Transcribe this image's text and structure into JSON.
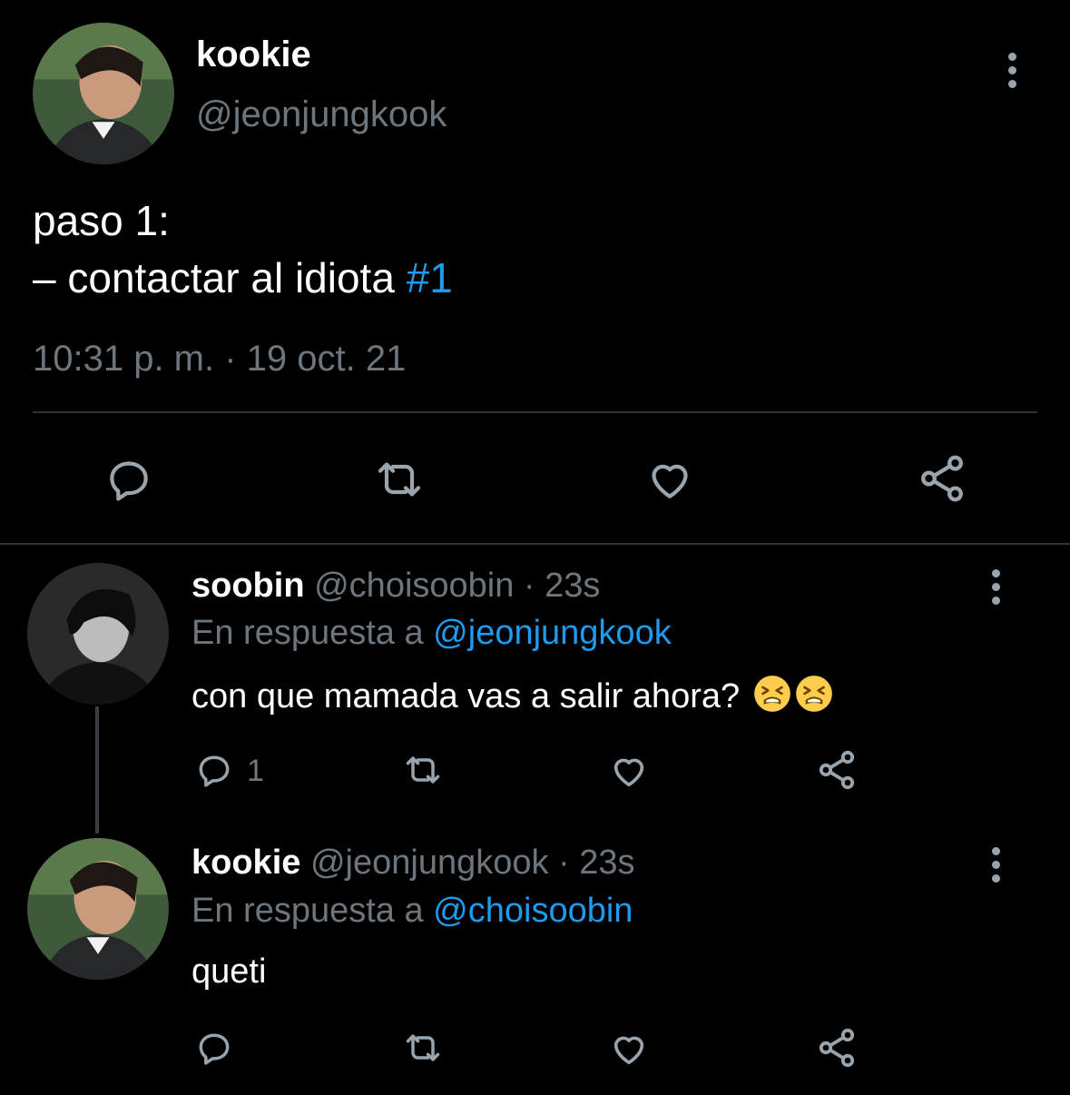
{
  "main_tweet": {
    "name": "kookie",
    "handle": "@jeonjungkook",
    "text_line1": "paso 1:",
    "text_line2_prefix": "– contactar al idiota ",
    "hashtag": "#1",
    "timestamp": "10:31 p. m. · 19 oct. 21",
    "actions": [
      "reply-icon",
      "retweet-icon",
      "like-icon",
      "share-icon"
    ]
  },
  "replies": [
    {
      "name": "soobin",
      "meta": "@choisoobin · 23s",
      "reply_to_label": "En respuesta a ",
      "reply_to_mention": "@jeonjungkook",
      "text": "con que mamada vas a salir ahora? ",
      "emoji": "tired-face-emoji",
      "reply_count": "1"
    },
    {
      "name": "kookie",
      "meta": "@jeonjungkook · 23s",
      "reply_to_label": "En respuesta a ",
      "reply_to_mention": "@choisoobin",
      "text": "queti"
    }
  ],
  "colors": {
    "background": "#000000",
    "text": "#ffffff",
    "secondary": "#6e767d",
    "accent": "#1d9bf0",
    "divider": "#2f3336"
  }
}
